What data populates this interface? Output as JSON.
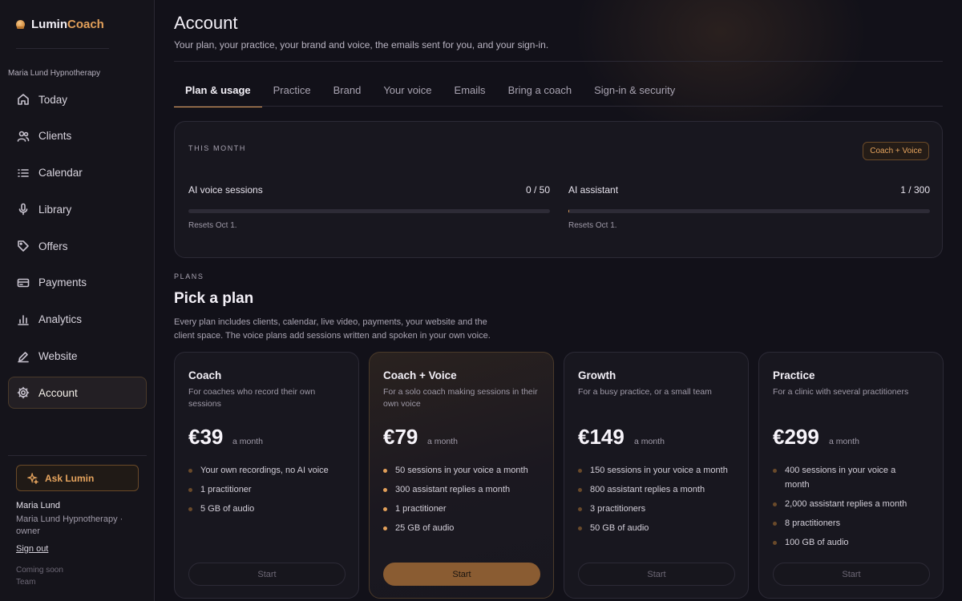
{
  "brand": {
    "part1": "Lumin",
    "part2": "Coach"
  },
  "sidebar": {
    "practice_name": "Maria Lund Hypnotherapy",
    "items": [
      {
        "label": "Today",
        "icon": "home-icon"
      },
      {
        "label": "Clients",
        "icon": "users-icon"
      },
      {
        "label": "Calendar",
        "icon": "list-icon"
      },
      {
        "label": "Library",
        "icon": "microphone-icon"
      },
      {
        "label": "Offers",
        "icon": "tag-icon"
      },
      {
        "label": "Payments",
        "icon": "card-icon"
      },
      {
        "label": "Analytics",
        "icon": "bar-chart-icon"
      },
      {
        "label": "Website",
        "icon": "edit-icon"
      },
      {
        "label": "Account",
        "icon": "gear-icon",
        "active": true
      }
    ],
    "ask_label": "Ask Lumin",
    "user_name": "Maria Lund",
    "user_role": "Maria Lund Hypnotherapy · owner",
    "sign_out": "Sign out",
    "coming_soon": "Coming soon",
    "team": "Team"
  },
  "header": {
    "title": "Account",
    "subtitle": "Your plan, your practice, your brand and voice, the emails sent for you, and your sign-in."
  },
  "tabs": [
    {
      "label": "Plan & usage",
      "active": true
    },
    {
      "label": "Practice"
    },
    {
      "label": "Brand"
    },
    {
      "label": "Your voice"
    },
    {
      "label": "Emails"
    },
    {
      "label": "Bring a coach"
    },
    {
      "label": "Sign-in & security"
    }
  ],
  "usage": {
    "heading": "THIS MONTH",
    "badge": "Coach + Voice",
    "meters": [
      {
        "label": "AI voice sessions",
        "value": "0 / 50",
        "fraction": 0.0,
        "reset": "Resets Oct 1."
      },
      {
        "label": "AI assistant",
        "value": "1 / 300",
        "fraction": 0.0033,
        "reset": "Resets Oct 1."
      }
    ]
  },
  "plans": {
    "label": "PLANS",
    "title": "Pick a plan",
    "description": "Every plan includes clients, calendar, live video, payments, your website and the client space. The voice plans add sessions written and spoken in your own voice.",
    "cards": [
      {
        "name": "Coach",
        "desc": "For coaches who record their own sessions",
        "price": "€39",
        "per": "a month",
        "features": [
          "Your own recordings, no AI voice",
          "1 practitioner",
          "5 GB of audio"
        ],
        "cta": "Start"
      },
      {
        "name": "Coach + Voice",
        "desc": "For a solo coach making sessions in their own voice",
        "price": "€79",
        "per": "a month",
        "features": [
          "50 sessions in your voice a month",
          "300 assistant replies a month",
          "1 practitioner",
          "25 GB of audio"
        ],
        "cta": "Start",
        "featured": true
      },
      {
        "name": "Growth",
        "desc": "For a busy practice, or a small team",
        "price": "€149",
        "per": "a month",
        "features": [
          "150 sessions in your voice a month",
          "800 assistant replies a month",
          "3 practitioners",
          "50 GB of audio"
        ],
        "cta": "Start"
      },
      {
        "name": "Practice",
        "desc": "For a clinic with several practitioners",
        "price": "€299",
        "per": "a month",
        "features": [
          "400 sessions in your voice a month",
          "2,000 assistant replies a month",
          "8 practitioners",
          "100 GB of audio"
        ],
        "cta": "Start"
      }
    ]
  },
  "colors": {
    "accent": "#e3a05a",
    "background": "#121119",
    "card": "#18171f"
  }
}
